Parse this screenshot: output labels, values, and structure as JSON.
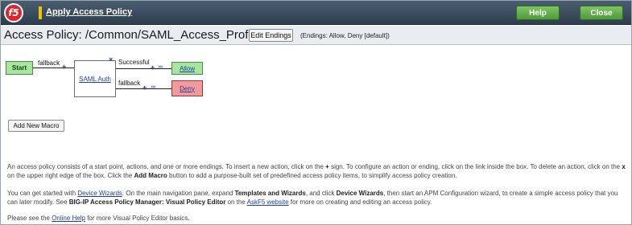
{
  "topbar": {
    "logo_text": "f5",
    "title": "Apply Access Policy",
    "help_label": "Help",
    "close_label": "Close"
  },
  "header": {
    "policy_title": "Access Policy: /Common/SAML_Access_Profile",
    "edit_endings_label": "Edit Endings",
    "endings_note": "(Endings: Allow, Deny [default])"
  },
  "diagram": {
    "start_label": "Start",
    "start_branch": "fallback",
    "action_label": "SAML Auth",
    "close_glyph": "×",
    "branch_successful": "Successful",
    "branch_fallback": "fallback",
    "ending_allow": "Allow",
    "ending_deny": "Deny",
    "plus_glyph": "+",
    "arrow_glyph": "»»"
  },
  "add_macro_label": "Add New Macro",
  "info": {
    "p1_a": "An access policy consists of a start point, actions, and one or more endings. To insert a new action, click on the ",
    "p1_plus": "+",
    "p1_b": " sign. To configure an action or ending, click on the link inside the box. To delete an action, click on the ",
    "p1_x": "x",
    "p1_c": " on the upper right edge of the box. Click the ",
    "p1_macro": "Add Macro",
    "p1_d": " button to add a purpose-built set of predefined access policy items, to simplify access policy creation.",
    "p2_a": "You can get started with ",
    "p2_link1": "Device Wizards",
    "p2_b": ". On the main navigation pane, expand ",
    "p2_tw": "Templates and Wizards",
    "p2_c": ", and click ",
    "p2_dw": "Device Wizards",
    "p2_d": ", then start an APM Configuration wizard, to create a simple access policy that you can later modify. See ",
    "p2_book": "BIG-IP Access Policy Manager: Visual Policy Editor",
    "p2_e": " on the ",
    "p2_link2": "AskF5 website",
    "p2_f": " for more on creating and editing an access policy.",
    "p3_a": "Please see the ",
    "p3_link": "Online Help",
    "p3_b": " for more Visual Policy Editor basics."
  },
  "colors": {
    "topbar": "#3b4d5f",
    "help_close_green": "#5fae49",
    "start_allow_green": "#a8e6a0",
    "deny_red": "#f49a9a",
    "link_blue": "#1c3ea8",
    "logo_red": "#e2222a"
  }
}
